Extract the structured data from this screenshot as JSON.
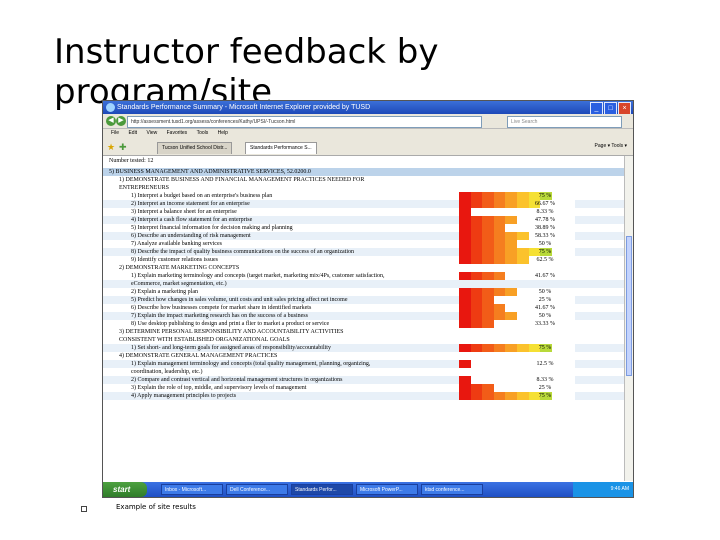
{
  "slide": {
    "title": "Instructor feedback by program/site",
    "caption": "Example of site results"
  },
  "browser": {
    "window_title": "Standards Performance Summary - Microsoft Internet Explorer provided by TUSD",
    "address": "http://assessment.tusd1.org/assess/conferences/Kathy/UPSI/-Tucson.html",
    "search_placeholder": "Live Search",
    "menu": [
      "File",
      "Edit",
      "View",
      "Favorites",
      "Tools",
      "Help"
    ],
    "tabs": [
      "Tucson Unified School Distr...",
      "Standards Performance S..."
    ],
    "tools_label": "Page ▾  Tools ▾",
    "win_buttons": [
      "_",
      "□",
      "×"
    ]
  },
  "report": {
    "number_tested": "Number tested: 12",
    "rows": [
      {
        "kind": "section",
        "text": "5) BUSINESS MANAGEMENT AND ADMINISTRATIVE SERVICES, 52.0200.0",
        "pct": ""
      },
      {
        "kind": "sub",
        "text": "1) DEMONSTRATE BUSINESS AND FINANCIAL MANAGEMENT PRACTICES NEEDED FOR",
        "pct": ""
      },
      {
        "kind": "sub",
        "text": "ENTREPRENEURS",
        "pct": ""
      },
      {
        "kind": "item",
        "text": "1) Interpret a budget based on an enterprise's business plan",
        "pct": "75 %",
        "fill": 0.75
      },
      {
        "kind": "item",
        "text": "2) Interpret an income statement for an enterprise",
        "pct": "66.67 %",
        "fill": 0.67
      },
      {
        "kind": "item",
        "text": "3) Interpret a balance sheet for an enterprise",
        "pct": "8.33 %",
        "fill": 0.08
      },
      {
        "kind": "item",
        "text": "4) Interpret a cash flow statement for an enterprise",
        "pct": "47.78 %",
        "fill": 0.48
      },
      {
        "kind": "item",
        "text": "5) Interpret financial information for decision making and planning",
        "pct": "38.89 %",
        "fill": 0.39
      },
      {
        "kind": "item",
        "text": "6) Describe an understanding of risk management",
        "pct": "58.33 %",
        "fill": 0.58
      },
      {
        "kind": "item",
        "text": "7) Analyze available banking services",
        "pct": "50 %",
        "fill": 0.5
      },
      {
        "kind": "item",
        "text": "8) Describe the impact of quality business communications on the success of an organization",
        "pct": "75 %",
        "fill": 0.75
      },
      {
        "kind": "item",
        "text": "9) Identify customer relations issues",
        "pct": "62.5 %",
        "fill": 0.63
      },
      {
        "kind": "sub",
        "text": "2) DEMONSTRATE MARKETING CONCEPTS",
        "pct": ""
      },
      {
        "kind": "item",
        "text": "1) Explain marketing terminology and concepts (target market, marketing mix/4Ps, customer satisfaction,",
        "pct": "41.67 %",
        "fill": 0.42
      },
      {
        "kind": "item",
        "text": "eCommerce, market segmentation, etc.)",
        "pct": ""
      },
      {
        "kind": "item",
        "text": "2) Explain a marketing plan",
        "pct": "50 %",
        "fill": 0.5
      },
      {
        "kind": "item",
        "text": "5) Predict how changes in sales volume, unit costs and unit sales pricing affect net income",
        "pct": "25 %",
        "fill": 0.25
      },
      {
        "kind": "item",
        "text": "6) Describe how businesses compete for market share in identified markets",
        "pct": "41.67 %",
        "fill": 0.42
      },
      {
        "kind": "item",
        "text": "7) Explain the impact marketing research has on the success of a business",
        "pct": "50 %",
        "fill": 0.5
      },
      {
        "kind": "item",
        "text": "8) Use desktop publishing to design and print a flier to market a product or service",
        "pct": "33.33 %",
        "fill": 0.33
      },
      {
        "kind": "sub",
        "text": "3) DETERMINE PERSONAL RESPONSIBILITY AND ACCOUNTABILITY ACTIVITIES",
        "pct": ""
      },
      {
        "kind": "sub",
        "text": "CONSISTENT WITH ESTABLISHED ORGANIZATIONAL GOALS",
        "pct": ""
      },
      {
        "kind": "item",
        "text": "1) Set short- and long-term goals for assigned areas of responsibility/accountability",
        "pct": "75 %",
        "fill": 0.75
      },
      {
        "kind": "sub",
        "text": "4) DEMONSTRATE GENERAL MANAGEMENT PRACTICES",
        "pct": ""
      },
      {
        "kind": "item",
        "text": "1) Explain management terminology and concepts (total quality management, planning, organizing,",
        "pct": "12.5 %",
        "fill": 0.13
      },
      {
        "kind": "item",
        "text": "coordination, leadership, etc.)",
        "pct": ""
      },
      {
        "kind": "item",
        "text": "2) Compare and contrast vertical and horizontal management structures in organizations",
        "pct": "8.33 %",
        "fill": 0.08
      },
      {
        "kind": "item",
        "text": "3) Explain the role of top, middle, and supervisory levels of management",
        "pct": "25 %",
        "fill": 0.25
      },
      {
        "kind": "item",
        "text": "4) Apply management principles to projects",
        "pct": "75 %",
        "fill": 0.75
      }
    ]
  },
  "taskbar": {
    "start": "start",
    "buttons": [
      "Inbox - Microsoft...",
      "Dell Conference...",
      "Standards Perfor...",
      "Microsoft PowerP...",
      "ktsd conference..."
    ],
    "clock": "9:46 AM"
  },
  "colors": {
    "heat": [
      "#e8170f",
      "#ee3b12",
      "#f25c18",
      "#f57e1f",
      "#f8a025",
      "#fbc22c",
      "#f5e034",
      "#b8d93a",
      "#7cc93f",
      "#3fb845"
    ],
    "section_bg": "#bcd3ea"
  }
}
